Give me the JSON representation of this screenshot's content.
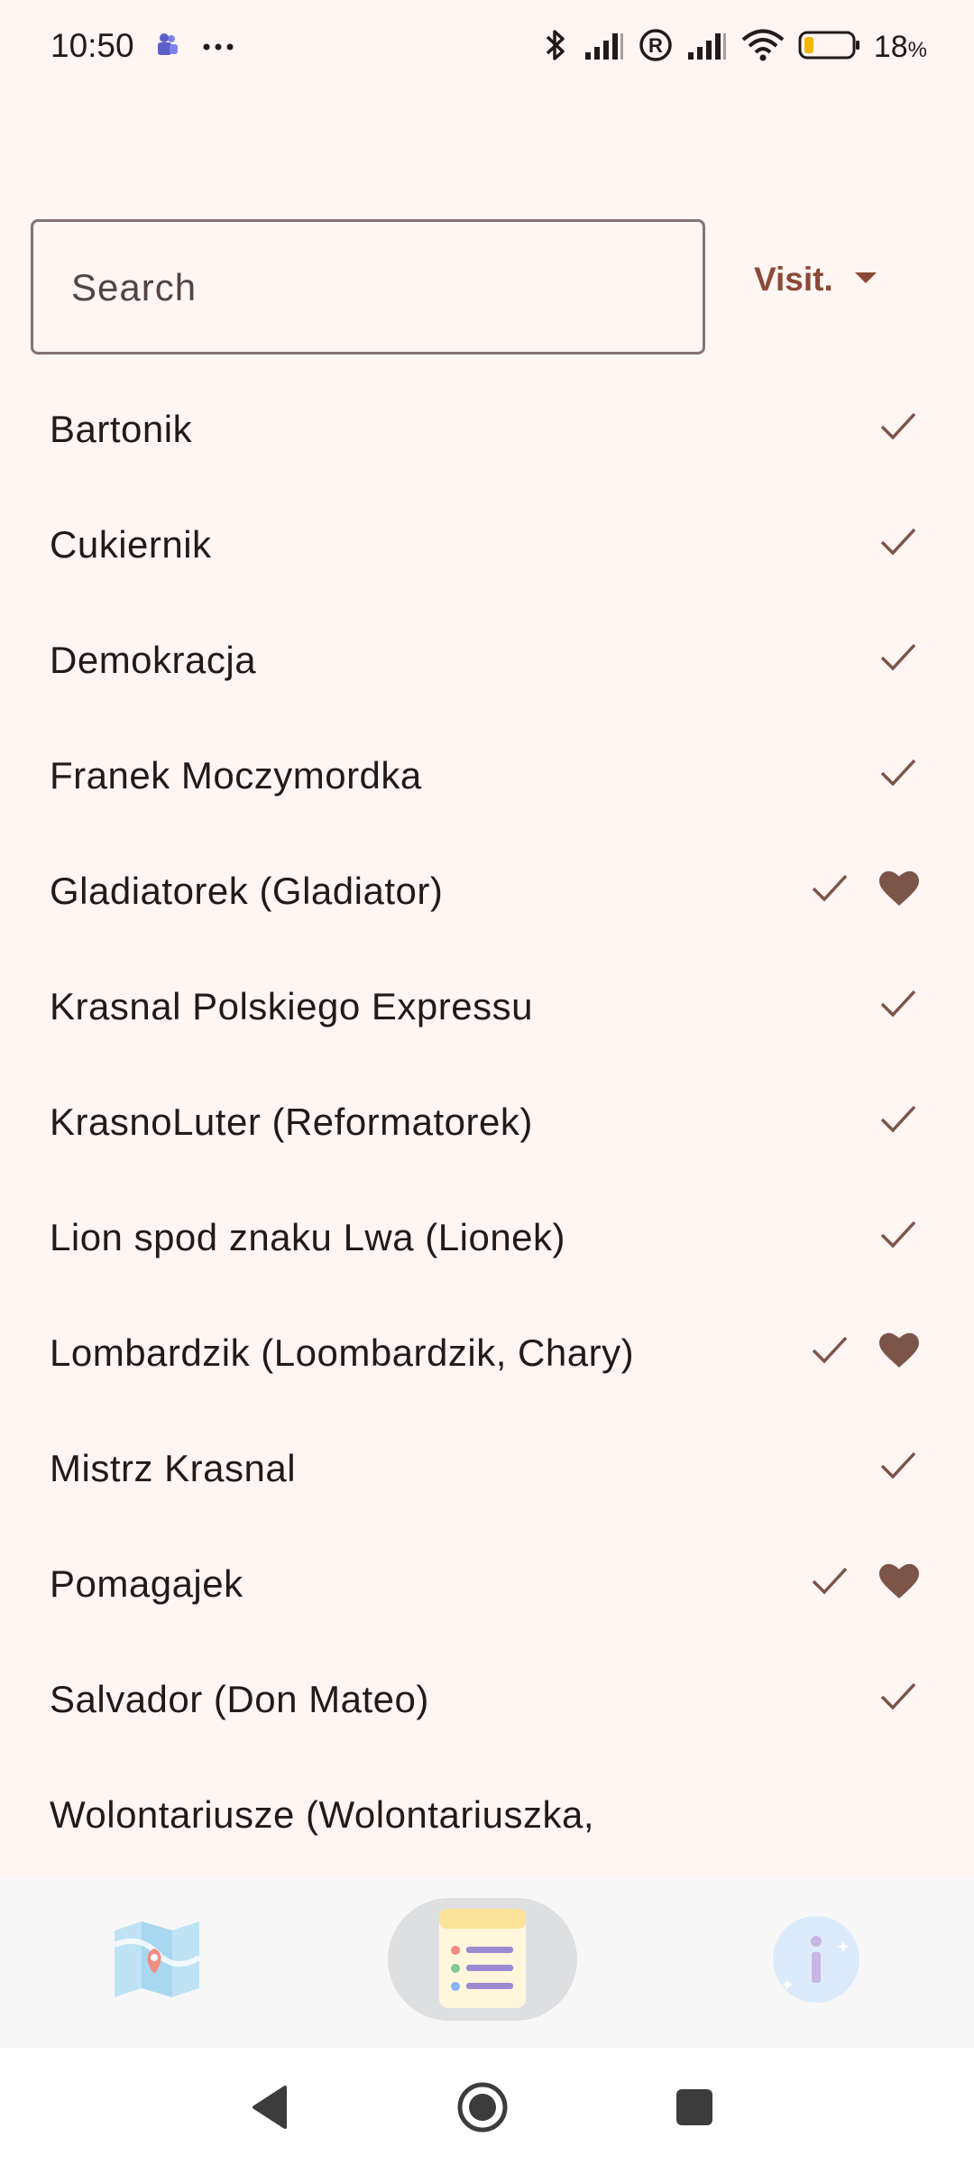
{
  "status_bar": {
    "time": "10:50",
    "battery_percent": "18",
    "battery_unit": "%"
  },
  "search": {
    "placeholder": "Search",
    "value": ""
  },
  "filter": {
    "selected": "Visit."
  },
  "items": [
    {
      "name": "Bartonik",
      "visited": true,
      "favorite": false
    },
    {
      "name": "Cukiernik",
      "visited": true,
      "favorite": false
    },
    {
      "name": "Demokracja",
      "visited": true,
      "favorite": false
    },
    {
      "name": "Franek Moczymordka",
      "visited": true,
      "favorite": false
    },
    {
      "name": "Gladiatorek (Gladiator)",
      "visited": true,
      "favorite": true
    },
    {
      "name": "Krasnal Polskiego Expressu",
      "visited": true,
      "favorite": false
    },
    {
      "name": "KrasnoLuter (Reformatorek)",
      "visited": true,
      "favorite": false
    },
    {
      "name": "Lion spod znaku Lwa (Lionek)",
      "visited": true,
      "favorite": false
    },
    {
      "name": "Lombardzik (Loombardzik, Chary)",
      "visited": true,
      "favorite": true
    },
    {
      "name": "Mistrz Krasnal",
      "visited": true,
      "favorite": false
    },
    {
      "name": "Pomagajek",
      "visited": true,
      "favorite": true
    },
    {
      "name": "Salvador (Don Mateo)",
      "visited": true,
      "favorite": false
    },
    {
      "name": "Wolontariusze (Wolontariuszka,",
      "visited": false,
      "favorite": false
    }
  ],
  "bottom_nav": {
    "items": [
      {
        "icon": "map-icon",
        "selected": false
      },
      {
        "icon": "list-icon",
        "selected": true
      },
      {
        "icon": "info-icon",
        "selected": false
      }
    ]
  },
  "colors": {
    "background": "#FFF5F3",
    "accent": "#8B4A36",
    "icon": "#7B5547"
  }
}
